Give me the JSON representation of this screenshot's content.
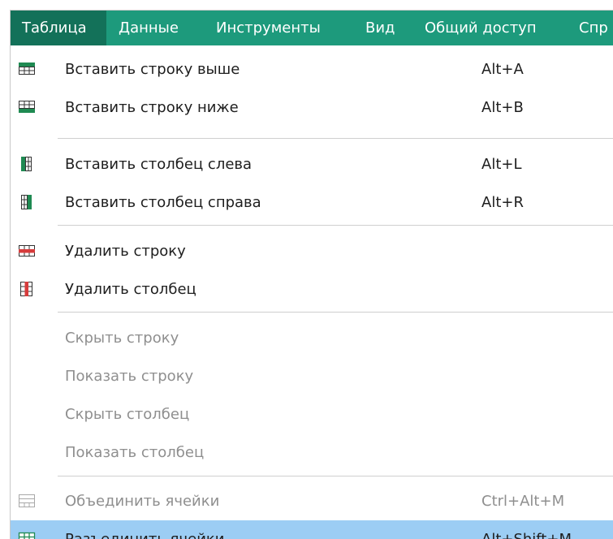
{
  "menubar": {
    "tabs": [
      {
        "label": "Таблица",
        "active": true
      },
      {
        "label": "Данные",
        "active": false
      },
      {
        "label": "Инструменты",
        "active": false
      },
      {
        "label": "Вид",
        "active": false
      },
      {
        "label": "Общий доступ",
        "active": false
      },
      {
        "label": "Спр",
        "active": false
      }
    ]
  },
  "menu": {
    "items": [
      {
        "label": "Вставить строку выше",
        "shortcut": "Alt+A",
        "icon": "insert-row-above-icon",
        "enabled": true
      },
      {
        "label": "Вставить строку ниже",
        "shortcut": "Alt+B",
        "icon": "insert-row-below-icon",
        "enabled": true
      },
      {
        "label": "Вставить столбец слева",
        "shortcut": "Alt+L",
        "icon": "insert-column-left-icon",
        "enabled": true
      },
      {
        "label": "Вставить столбец справа",
        "shortcut": "Alt+R",
        "icon": "insert-column-right-icon",
        "enabled": true
      },
      {
        "label": "Удалить строку",
        "shortcut": "",
        "icon": "delete-row-icon",
        "enabled": true
      },
      {
        "label": "Удалить столбец",
        "shortcut": "",
        "icon": "delete-column-icon",
        "enabled": true
      },
      {
        "label": "Скрыть строку",
        "shortcut": "",
        "icon": "",
        "enabled": false
      },
      {
        "label": "Показать строку",
        "shortcut": "",
        "icon": "",
        "enabled": false
      },
      {
        "label": "Скрыть столбец",
        "shortcut": "",
        "icon": "",
        "enabled": false
      },
      {
        "label": "Показать столбец",
        "shortcut": "",
        "icon": "",
        "enabled": false
      },
      {
        "label": "Объединить ячейки",
        "shortcut": "Ctrl+Alt+M",
        "icon": "merge-cells-icon",
        "enabled": false
      },
      {
        "label": "Разъединить ячейки",
        "shortcut": "Alt+Shift+M",
        "icon": "split-cells-icon",
        "enabled": true,
        "highlighted": true
      }
    ]
  },
  "colors": {
    "menubar_bg": "#1d9a7c",
    "active_tab_bg": "#137159",
    "icon_green": "#1f8a52",
    "icon_red": "#d63c3c",
    "highlight_bg": "#9ccdf4",
    "disabled_text": "#8f8f8f"
  }
}
